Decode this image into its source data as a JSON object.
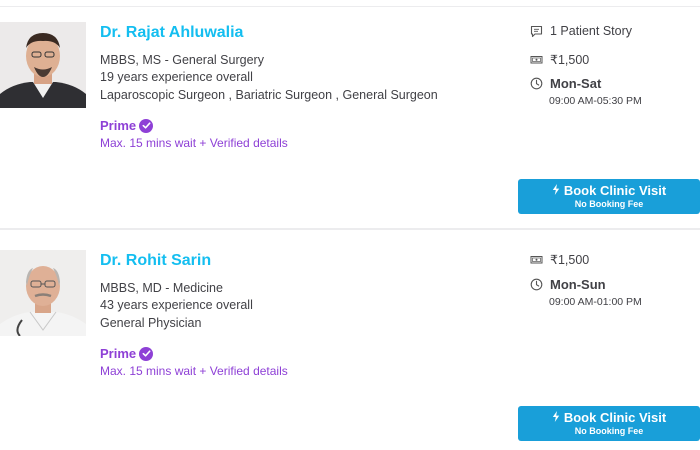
{
  "doctors": [
    {
      "name": "Dr. Rajat Ahluwalia",
      "degrees": "MBBS, MS - General Surgery",
      "experience": "19 years experience overall",
      "specialties": "Laparoscopic Surgeon , Bariatric Surgeon , General Surgeon",
      "prime_label": "Prime",
      "prime_note": "Max. 15 mins wait + Verified details",
      "patient_stories": "1 Patient Story",
      "fee": "₹1,500",
      "days": "Mon-Sat",
      "hours": "09:00 AM-05:30 PM",
      "book_label": "Book Clinic Visit",
      "book_sub": "No Booking Fee"
    },
    {
      "name": "Dr. Rohit Sarin",
      "degrees": "MBBS, MD - Medicine",
      "experience": "43 years experience overall",
      "specialties": "General Physician",
      "prime_label": "Prime",
      "prime_note": "Max. 15 mins wait + Verified details",
      "fee": "₹1,500",
      "days": "Mon-Sun",
      "hours": "09:00 AM-01:00 PM",
      "book_label": "Book Clinic Visit",
      "book_sub": "No Booking Fee"
    }
  ],
  "icons": {
    "story": "chat-bubble-icon",
    "fee": "money-note-icon",
    "timing": "clock-icon",
    "verified": "check-badge-icon",
    "book": "lightning-bolt-icon"
  },
  "colors": {
    "doctor_name": "#14bef0",
    "prime": "#8e40d6",
    "book_button": "#199fd9",
    "text": "#414146"
  }
}
